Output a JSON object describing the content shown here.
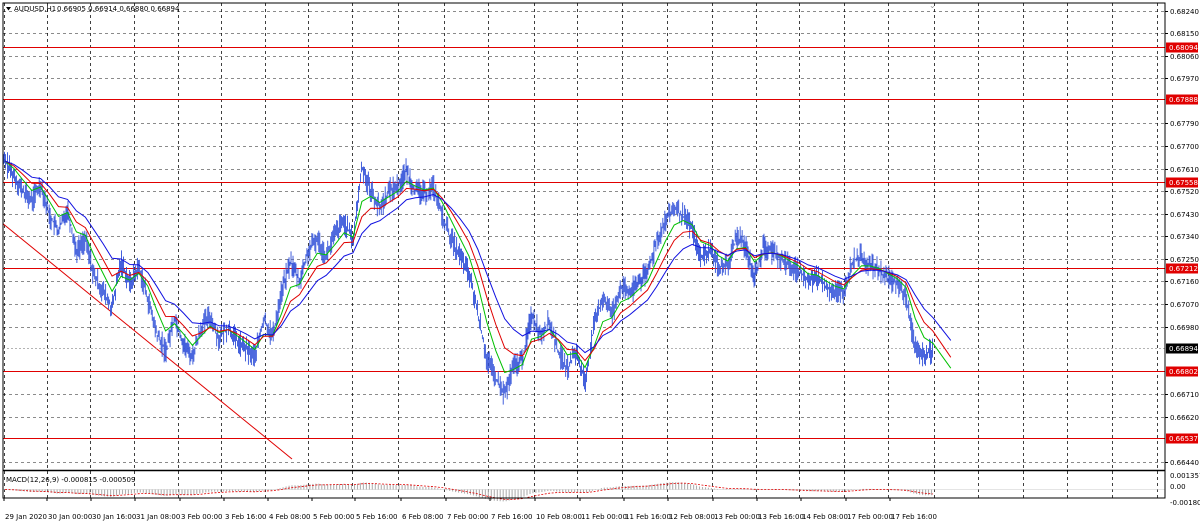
{
  "header": {
    "symbol_label": "AUDUSD,H1",
    "ohlc": "0.66905 0.66914 0.66880 0.66894",
    "macd_label": "MACD(12,26,9) -0.000815 -0.000509"
  },
  "colors": {
    "grid": "#000000",
    "candle": "#2f4fd8",
    "ma_fast": "#00c000",
    "ma_mid": "#e00000",
    "ma_slow": "#1010e0",
    "level": "#e00000",
    "trendline": "#e00000",
    "macd_hist": "#b0b0b0",
    "macd_signal": "#e00000"
  },
  "price_axis": {
    "ticks": [
      "0.68240",
      "0.68150",
      "0.68060",
      "0.67970",
      "0.67790",
      "0.67700",
      "0.67610",
      "0.67520",
      "0.67430",
      "0.67340",
      "0.67250",
      "0.67160",
      "0.67070",
      "0.66980",
      "0.66710",
      "0.66620",
      "0.66440"
    ],
    "current_price": "0.66894"
  },
  "levels": [
    "0.68094",
    "0.67888",
    "0.67558",
    "0.67212",
    "0.66802",
    "0.66537"
  ],
  "macd_axis": {
    "ticks": [
      "0.001357",
      "0.00",
      "-0.001807"
    ]
  },
  "time_axis": {
    "labels": [
      "29 Jan 2020",
      "30 Jan 00:00",
      "30 Jan 16:00",
      "31 Jan 08:00",
      "3 Feb 00:00",
      "3 Feb 16:00",
      "4 Feb 08:00",
      "5 Feb 00:00",
      "5 Feb 16:00",
      "6 Feb 08:00",
      "7 Feb 00:00",
      "7 Feb 16:00",
      "10 Feb 08:00",
      "11 Feb 00:00",
      "11 Feb 16:00",
      "12 Feb 08:00",
      "13 Feb 00:00",
      "13 Feb 16:00",
      "14 Feb 08:00",
      "17 Feb 00:00",
      "17 Feb 16:00"
    ]
  },
  "chart_data": {
    "type": "line",
    "series": [
      {
        "values": [
          0.6764,
          0.6758,
          0.6752,
          0.6748,
          0.6755,
          0.6742,
          0.6736,
          0.6745,
          0.6728,
          0.6733,
          0.6718,
          0.6712,
          0.6705,
          0.6724,
          0.6715,
          0.6722,
          0.6709,
          0.6695,
          0.6688,
          0.6702,
          0.6691,
          0.6686,
          0.6698,
          0.6702,
          0.6693,
          0.6698,
          0.6692,
          0.6689,
          0.6686,
          0.6701,
          0.6694,
          0.6712,
          0.6724,
          0.6716,
          0.6728,
          0.6733,
          0.6726,
          0.6735,
          0.674,
          0.6732,
          0.6762,
          0.6752,
          0.6745,
          0.6752,
          0.6754,
          0.676,
          0.6752,
          0.6751,
          0.6754,
          0.6742,
          0.6733,
          0.6726,
          0.6719,
          0.6703,
          0.6685,
          0.6677,
          0.6671,
          0.6682,
          0.6685,
          0.6703,
          0.6695,
          0.67,
          0.6688,
          0.6681,
          0.6688,
          0.6676,
          0.6698,
          0.671,
          0.6703,
          0.6714,
          0.6711,
          0.6716,
          0.6719,
          0.6732,
          0.674,
          0.6745,
          0.6742,
          0.6737,
          0.6725,
          0.6729,
          0.6722,
          0.6722,
          0.6734,
          0.673,
          0.6718,
          0.673,
          0.6728,
          0.6725,
          0.6722,
          0.672,
          0.6716,
          0.6718,
          0.6714,
          0.6712,
          0.6712,
          0.6724,
          0.6726,
          0.6722,
          0.672,
          0.6717,
          0.6715,
          0.671,
          0.6689,
          0.6686,
          0.6689
        ]
      }
    ]
  }
}
